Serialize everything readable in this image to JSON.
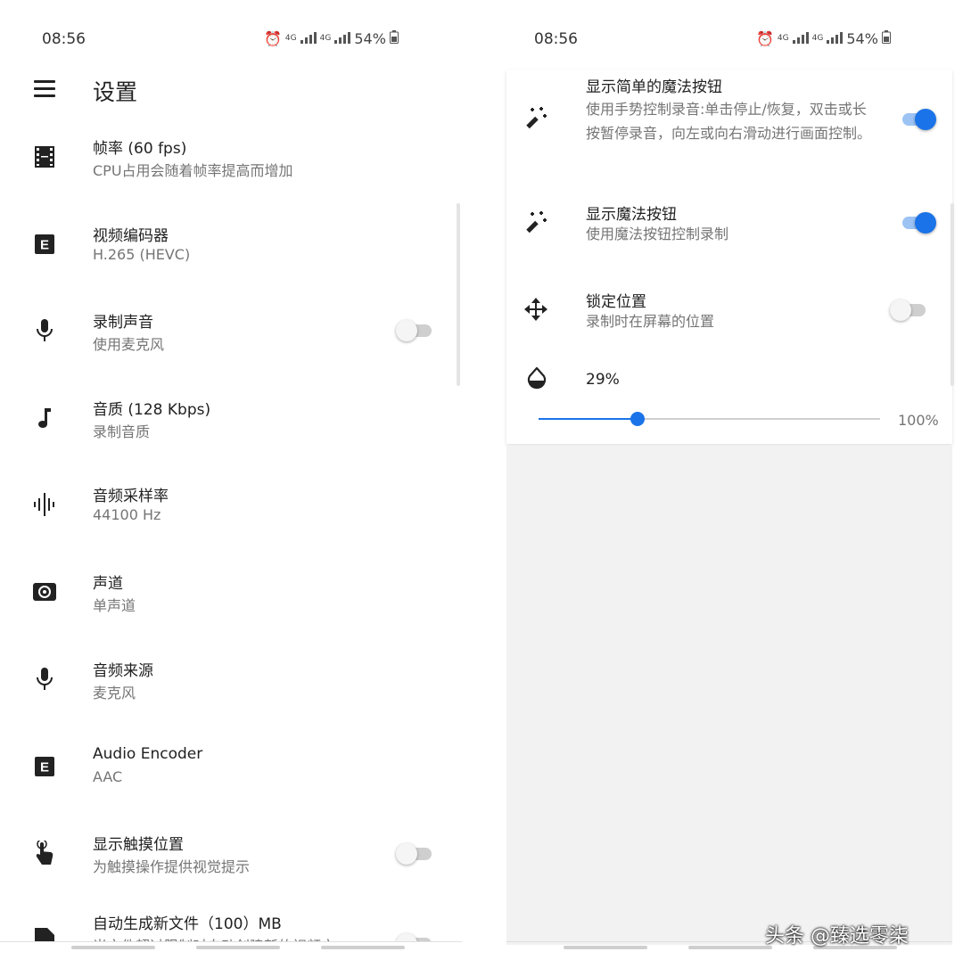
{
  "status_bar": {
    "time": "08:56",
    "signal_1": "4G",
    "signal_2": "4G",
    "battery": "54%"
  },
  "left": {
    "app_title": "设置",
    "settings": [
      {
        "title": "帧率 (60 fps)",
        "summary": "CPU占用会随着帧率提高而增加",
        "icon": "film-icon"
      },
      {
        "title": "视频编码器",
        "summary": "H.265 (HEVC)",
        "icon": "encoder-e-icon"
      },
      {
        "title": "录制声音",
        "summary": "使用麦克风",
        "icon": "microphone-icon",
        "toggle": false
      },
      {
        "title": "音质 (128 Kbps)",
        "summary": "录制音质",
        "icon": "music-note-icon"
      },
      {
        "title": "音频采样率",
        "summary": "44100 Hz",
        "icon": "waveform-icon"
      },
      {
        "title": "声道",
        "summary": "单声道",
        "icon": "speaker-icon"
      },
      {
        "title": "音频来源",
        "summary": "麦克风",
        "icon": "microphone-icon"
      },
      {
        "title": "Audio Encoder",
        "summary": "AAC",
        "icon": "encoder-e-icon"
      },
      {
        "title": "显示触摸位置",
        "summary": "为触摸操作提供视觉提示",
        "icon": "touch-icon",
        "toggle": false
      },
      {
        "title": "自动生成新文件（100）MB",
        "summary": "当文件超过限制时自动创建新的视频文",
        "icon": "file-icon",
        "toggle": false
      }
    ]
  },
  "right": {
    "settings": [
      {
        "title": "显示简单的魔法按钮",
        "summary": "使用手势控制录音:单击停止/恢复，双击或长按暂停录音，向左或向右滑动进行画面控制。",
        "icon": "magic-wand-icon",
        "toggle": true
      },
      {
        "title": "显示魔法按钮",
        "summary": "使用魔法按钮控制录制",
        "icon": "magic-wand-icon",
        "toggle": true
      },
      {
        "title": "锁定位置",
        "summary": "录制时在屏幕的位置",
        "icon": "move-arrows-icon",
        "toggle": false
      }
    ],
    "opacity": {
      "value_label": "29%",
      "max_label": "100%",
      "value": 0.29,
      "icon": "opacity-drop-icon"
    }
  },
  "watermark": "头条 @臻选零柒",
  "colors": {
    "accent": "#1a73e8",
    "track_on": "#9cc3f4",
    "track_off": "#cfcfcf",
    "summary": "#757575"
  }
}
